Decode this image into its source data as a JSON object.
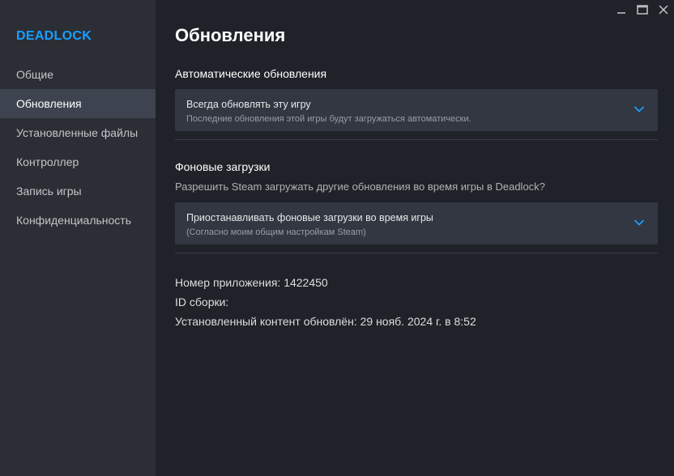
{
  "sidebar": {
    "app_title": "DEADLOCK",
    "items": [
      {
        "label": "Общие"
      },
      {
        "label": "Обновления"
      },
      {
        "label": "Установленные файлы"
      },
      {
        "label": "Контроллер"
      },
      {
        "label": "Запись игры"
      },
      {
        "label": "Конфиденциальность"
      }
    ],
    "active_index": 1
  },
  "main": {
    "title": "Обновления",
    "auto_updates": {
      "section_title": "Автоматические обновления",
      "dropdown_value": "Всегда обновлять эту игру",
      "dropdown_sub": "Последние обновления этой игры будут загружаться автоматически."
    },
    "background_downloads": {
      "section_title": "Фоновые загрузки",
      "description": "Разрешить Steam загружать другие обновления во время игры в Deadlock?",
      "dropdown_value": "Приостанавливать фоновые загрузки во время игры",
      "dropdown_sub": "(Согласно моим общим настройкам Steam)"
    },
    "info": {
      "app_id_line": "Номер приложения: 1422450",
      "build_id_line": "ID сборки:",
      "updated_line": "Установленный контент обновлён: 29 нояб. 2024 г. в 8:52"
    }
  },
  "window_controls": {
    "icons": [
      "minimize-icon",
      "maximize-icon",
      "close-icon"
    ]
  },
  "colors": {
    "accent": "#1a9fff",
    "background": "#1f2228",
    "sidebar": "#2b2e35",
    "active_item": "#3d4450",
    "dropdown": "#323741"
  }
}
